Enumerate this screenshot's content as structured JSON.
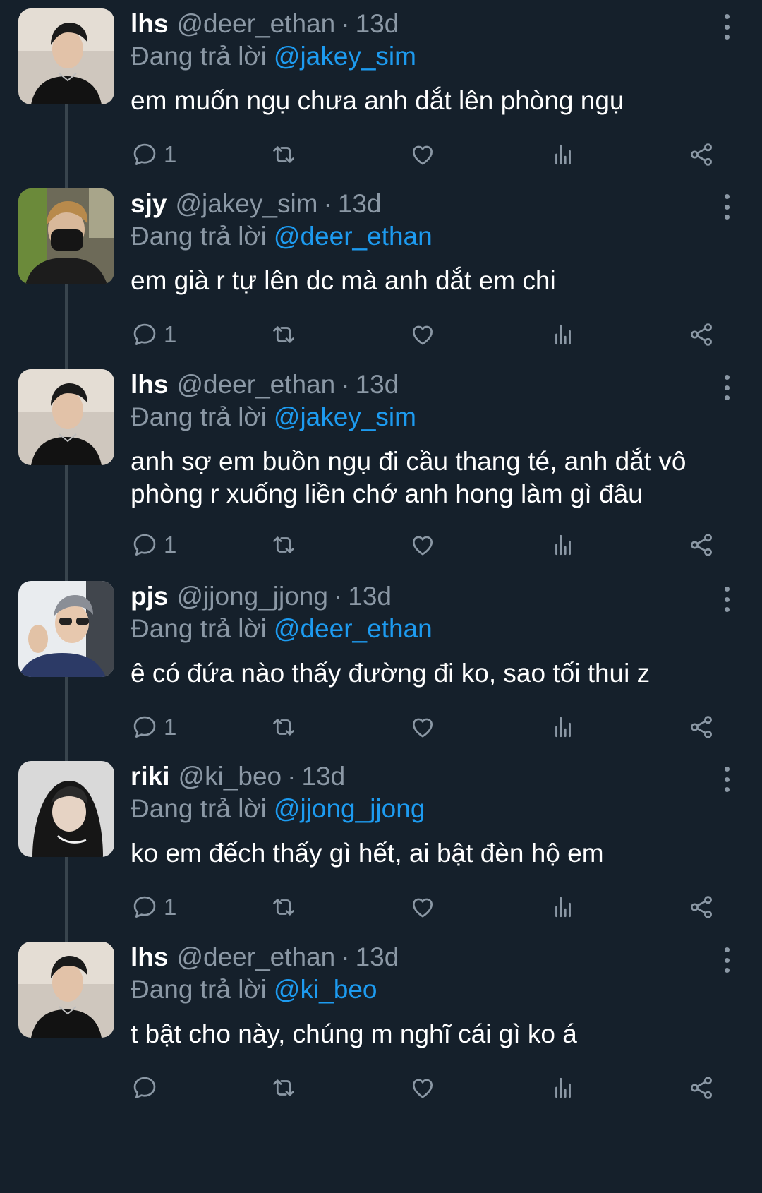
{
  "colors": {
    "background": "#15202b",
    "muted": "#8b98a5",
    "link": "#1d9bf0",
    "thread_line": "#38444d"
  },
  "icons": [
    "more-vertical-icon",
    "reply-icon",
    "retweet-icon",
    "like-icon",
    "views-icon",
    "share-icon"
  ],
  "thread": {
    "tweets": [
      {
        "display_name": "lhs",
        "handle": "@deer_ethan",
        "separator": "·",
        "time": "13d",
        "reply_prefix": "Đang trả lời",
        "reply_to": "@jakey_sim",
        "text": "em muốn ngụ chưa anh dắt lên phòng ngụ",
        "reply_count": "1"
      },
      {
        "display_name": "sjy",
        "handle": "@jakey_sim",
        "separator": "·",
        "time": "13d",
        "reply_prefix": "Đang trả lời",
        "reply_to": "@deer_ethan",
        "text": "em già r tự lên dc mà anh dắt em chi",
        "reply_count": "1"
      },
      {
        "display_name": "lhs",
        "handle": "@deer_ethan",
        "separator": "·",
        "time": "13d",
        "reply_prefix": "Đang trả lời",
        "reply_to": "@jakey_sim",
        "text": "anh sợ em buồn ngụ đi cầu thang té, anh dắt vô phòng r xuống liền chớ anh hong làm gì đâu",
        "reply_count": "1"
      },
      {
        "display_name": "pjs",
        "handle": "@jjong_jjong",
        "separator": "·",
        "time": "13d",
        "reply_prefix": "Đang trả lời",
        "reply_to": "@deer_ethan",
        "text": "ê có đứa nào thấy đường đi ko, sao tối thui z",
        "reply_count": "1"
      },
      {
        "display_name": "riki",
        "handle": "@ki_beo",
        "separator": "·",
        "time": "13d",
        "reply_prefix": "Đang trả lời",
        "reply_to": "@jjong_jjong",
        "text": "ko em đếch thấy gì hết, ai bật đèn hộ em",
        "reply_count": "1"
      },
      {
        "display_name": "lhs",
        "handle": "@deer_ethan",
        "separator": "·",
        "time": "13d",
        "reply_prefix": "Đang trả lời",
        "reply_to": "@ki_beo",
        "text": "t bật cho này, chúng m nghĩ cái gì ko á",
        "reply_count": ""
      }
    ]
  }
}
